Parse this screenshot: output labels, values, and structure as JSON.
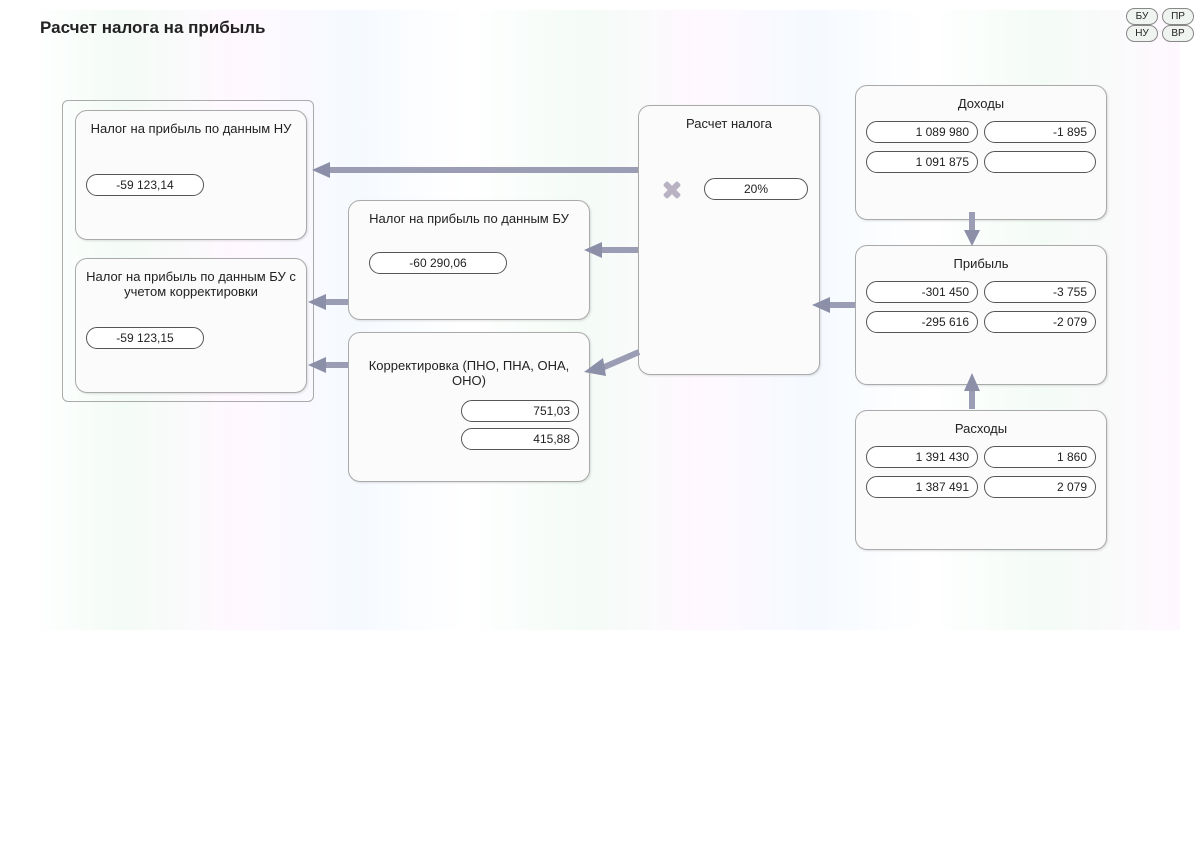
{
  "title": "Расчет налога на прибыль",
  "legend": {
    "bu": "БУ",
    "pr": "ПР",
    "nu": "НУ",
    "vr": "ВР"
  },
  "tax_calc": {
    "title": "Расчет налога",
    "rate": "20%"
  },
  "tax_nu": {
    "title": "Налог на прибыль по данным НУ",
    "value": "-59 123,14"
  },
  "tax_bu_corrected": {
    "title": "Налог на прибыль по данным БУ с учетом корректировки",
    "value": "-59 123,15"
  },
  "tax_bu": {
    "title": "Налог на прибыль по данным БУ",
    "value": "-60 290,06"
  },
  "adjustment": {
    "title": "Корректировка (ПНО, ПНА, ОНА, ОНО)",
    "v1": "751,03",
    "v2": "415,88"
  },
  "income": {
    "title": "Доходы",
    "bu": "1 089 980",
    "pr": "-1 895",
    "nu": "1 091 875",
    "vr": ""
  },
  "profit": {
    "title": "Прибыль",
    "bu": "-301 450",
    "pr": "-3 755",
    "nu": "-295 616",
    "vr": "-2 079"
  },
  "expense": {
    "title": "Расходы",
    "bu": "1 391 430",
    "pr": "1 860",
    "nu": "1 387 491",
    "vr": "2 079"
  }
}
